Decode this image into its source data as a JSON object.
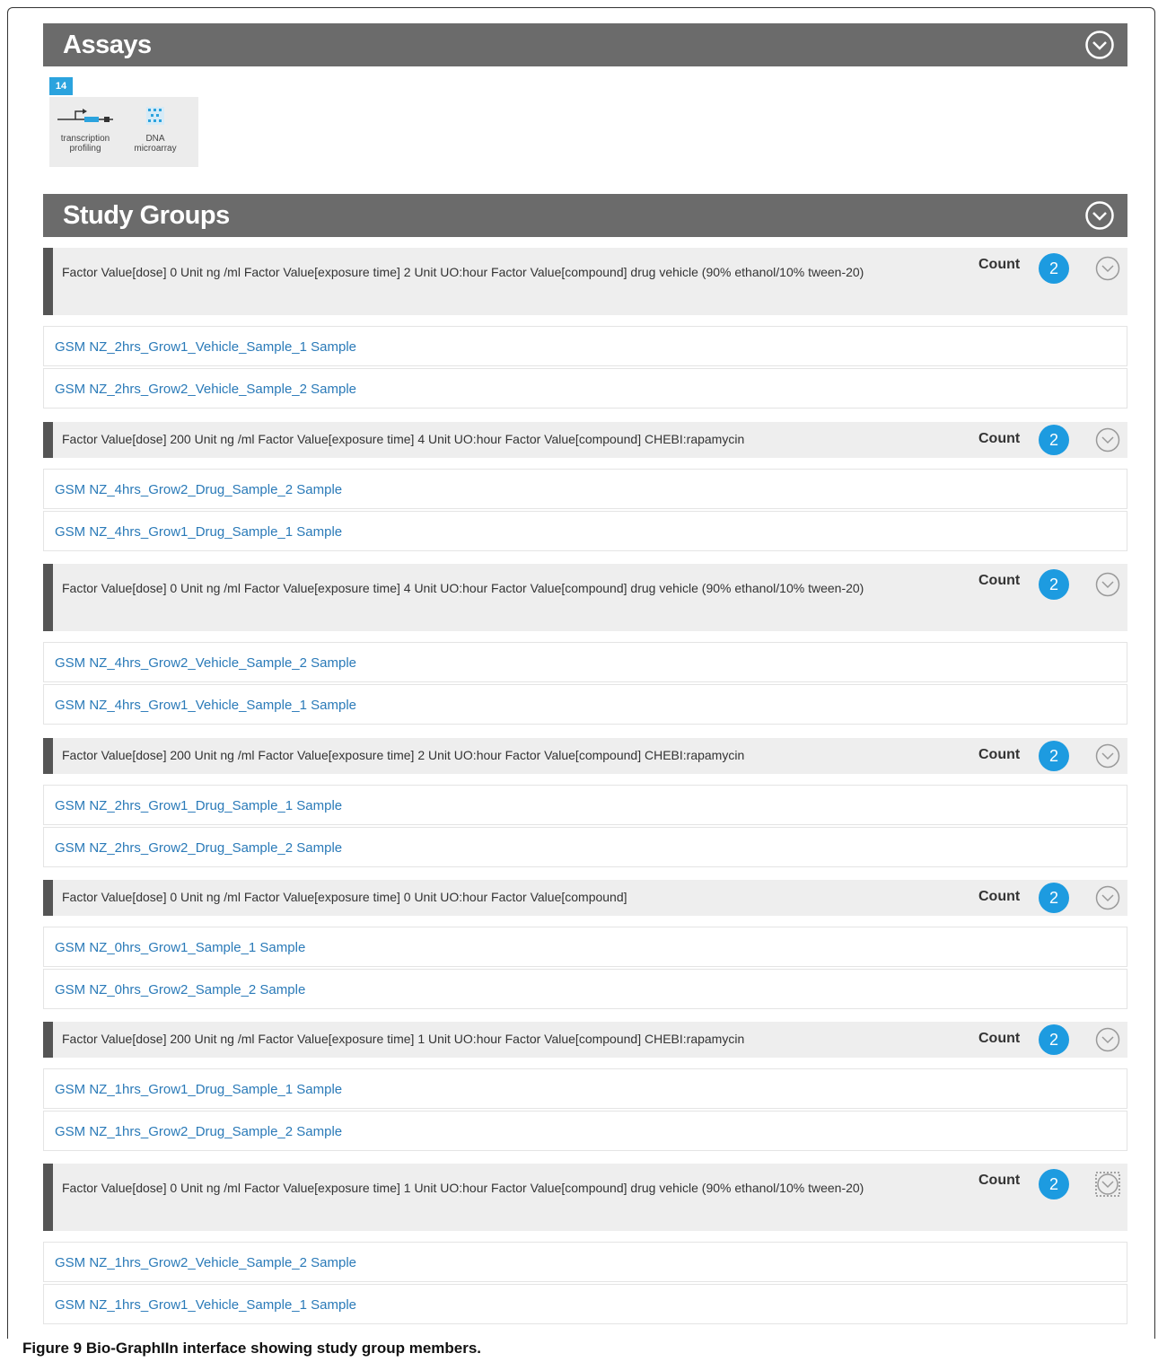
{
  "sections": {
    "assays": {
      "title": "Assays"
    },
    "study_groups": {
      "title": "Study Groups"
    }
  },
  "assays": {
    "count_badge": "14",
    "items": [
      {
        "label_line1": "transcription",
        "label_line2": "profiling",
        "icon": "transcription-profiling-icon"
      },
      {
        "label_line1": "DNA",
        "label_line2": "microarray",
        "icon": "dna-microarray-icon"
      }
    ]
  },
  "count_label": "Count",
  "groups": [
    {
      "factor": "Factor Value[dose] 0 Unit ng /ml Factor Value[exposure time] 2 Unit UO:hour Factor Value[compound] drug vehicle (90% ethanol/10% tween-20)",
      "count": "2",
      "members": [
        "GSM NZ_2hrs_Grow1_Vehicle_Sample_1 Sample",
        "GSM NZ_2hrs_Grow2_Vehicle_Sample_2 Sample"
      ]
    },
    {
      "factor": "Factor Value[dose] 200 Unit ng /ml Factor Value[exposure time] 4 Unit UO:hour Factor Value[compound] CHEBI:rapamycin",
      "count": "2",
      "members": [
        "GSM NZ_4hrs_Grow2_Drug_Sample_2 Sample",
        "GSM NZ_4hrs_Grow1_Drug_Sample_1 Sample"
      ]
    },
    {
      "factor": "Factor Value[dose] 0 Unit ng /ml Factor Value[exposure time] 4 Unit UO:hour Factor Value[compound] drug vehicle (90% ethanol/10% tween-20)",
      "count": "2",
      "members": [
        "GSM NZ_4hrs_Grow2_Vehicle_Sample_2 Sample",
        "GSM NZ_4hrs_Grow1_Vehicle_Sample_1 Sample"
      ]
    },
    {
      "factor": "Factor Value[dose] 200 Unit ng /ml Factor Value[exposure time] 2 Unit UO:hour Factor Value[compound] CHEBI:rapamycin",
      "count": "2",
      "members": [
        "GSM NZ_2hrs_Grow1_Drug_Sample_1 Sample",
        "GSM NZ_2hrs_Grow2_Drug_Sample_2 Sample"
      ]
    },
    {
      "factor": "Factor Value[dose] 0 Unit ng /ml Factor Value[exposure time] 0 Unit UO:hour Factor Value[compound]",
      "count": "2",
      "members": [
        "GSM NZ_0hrs_Grow1_Sample_1 Sample",
        "GSM NZ_0hrs_Grow2_Sample_2 Sample"
      ]
    },
    {
      "factor": "Factor Value[dose] 200 Unit ng /ml Factor Value[exposure time] 1 Unit UO:hour Factor Value[compound] CHEBI:rapamycin",
      "count": "2",
      "members": [
        "GSM NZ_1hrs_Grow1_Drug_Sample_1 Sample",
        "GSM NZ_1hrs_Grow2_Drug_Sample_2 Sample"
      ]
    },
    {
      "factor": "Factor Value[dose] 0 Unit ng /ml Factor Value[exposure time] 1 Unit UO:hour Factor Value[compound] drug vehicle (90% ethanol/10% tween-20)",
      "count": "2",
      "members": [
        "GSM NZ_1hrs_Grow2_Vehicle_Sample_2 Sample",
        "GSM NZ_1hrs_Grow1_Vehicle_Sample_1 Sample"
      ]
    }
  ],
  "caption": {
    "figure_label": "Figure 9",
    "text": "Bio-GraphIIn interface showing study group members."
  },
  "colors": {
    "section_bar": "#6b6b6b",
    "badge_blue": "#1d9be0",
    "link_blue": "#2a7ab8",
    "group_bg": "#eeeeee"
  }
}
